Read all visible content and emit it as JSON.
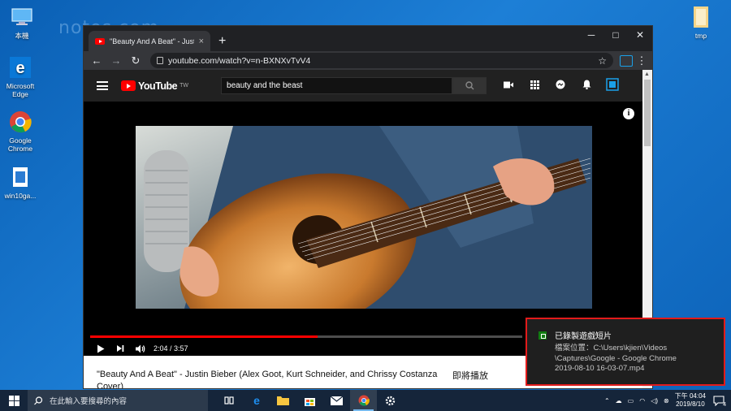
{
  "desktop": {
    "watermark": "notes.com",
    "icons": [
      {
        "label": "本機"
      },
      {
        "label": "Microsoft Edge"
      },
      {
        "label": "Google Chrome"
      },
      {
        "label": "win10ga..."
      },
      {
        "label": "tmp"
      }
    ]
  },
  "browser": {
    "tab_title": "\"Beauty And A Beat\" - Justin Bi",
    "tab_close": "×",
    "new_tab": "+",
    "url": "youtube.com/watch?v=n-BXNXvTvV4",
    "window_controls": {
      "minimize": "─",
      "maximize": "□",
      "close": "✕"
    }
  },
  "youtube": {
    "logo_text": "YouTube",
    "region": "TW",
    "search_value": "beauty and the beast",
    "player": {
      "time": "2:04 / 3:57",
      "progress": 0.527
    },
    "video_title": "\"Beauty And A Beat\" - Justin Bieber (Alex Goot, Kurt Schneider, and Chrissy Costanza Cover)",
    "up_next": "即將播放"
  },
  "notification": {
    "title": "已錄製遊戲短片",
    "body_line1": "檔案位置：C:\\Users\\kjien\\Videos",
    "body_line2": "\\Captures\\Google - Google Chrome",
    "body_line3": "2019-08-10 16-03-07.mp4"
  },
  "taskbar": {
    "search_placeholder": "在此輸入要搜尋的內容",
    "clock_time": "下午 04:04",
    "clock_date": "2019/8/10",
    "notification_count": "4"
  },
  "colors": {
    "accent_red": "#e21b1b",
    "youtube_red": "#ff0000",
    "taskbar_bg": "#15253a"
  }
}
